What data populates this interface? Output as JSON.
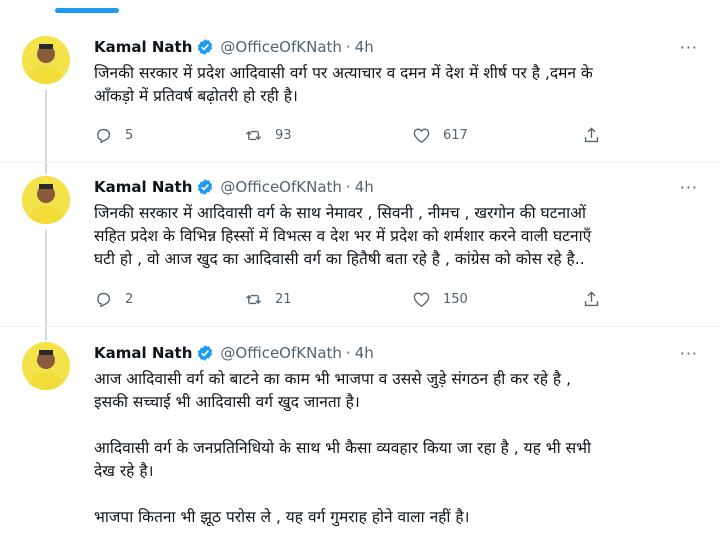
{
  "tweets": [
    {
      "name": "Kamal Nath",
      "handle": "@OfficeOfKNath",
      "time": "4h",
      "lines": [
        "जिनकी सरकार में प्रदेश आदिवासी वर्ग पर अत्याचार व दमन में देश में शीर्ष पर है ,दमन के",
        "आँकड़ो में प्रतिवर्ष बढ़ोतरी हो रही है।"
      ],
      "replies": "5",
      "retweets": "93",
      "likes": "617"
    },
    {
      "name": "Kamal Nath",
      "handle": "@OfficeOfKNath",
      "time": "4h",
      "lines": [
        "जिनकी सरकार में आदिवासी वर्ग के साथ नेमावर , सिवनी , नीमच , खरगोन की घटनाओं",
        "सहित प्रदेश के विभिन्न हिस्सों में विभत्स व देश भर में प्रदेश को शर्मशार करने वाली घटनाएँ",
        "घटी हो , वो आज खुद का आदिवासी वर्ग का हितैषी बता रहे है , कांग्रेस को कोस रहे है.."
      ],
      "replies": "2",
      "retweets": "21",
      "likes": "150"
    },
    {
      "name": "Kamal Nath",
      "handle": "@OfficeOfKNath",
      "time": "4h",
      "lines": [
        "आज आदिवासी वर्ग को बाटने का काम भी भाजपा व उससे जुड़े संगठन ही कर रहे है ,",
        "इसकी सच्चाई भी आदिवासी वर्ग खुद जानता है।",
        "",
        "आदिवासी वर्ग के जनप्रतिनिधियो के साथ भी कैसा व्यवहार किया जा रहा है , यह भी सभी",
        "देख रहे है।",
        "",
        "भाजपा कितना भी झूठ परोस ले , यह वर्ग गुमराह होने वाला नहीं है।"
      ]
    }
  ],
  "icons": {
    "reply": "reply-icon",
    "retweet": "retweet-icon",
    "like": "heart-icon",
    "share": "share-icon",
    "verified": "verified-badge-icon",
    "more": "more-icon"
  },
  "colors": {
    "accent": "#1d9bf0",
    "text": "#0f1419",
    "secondary": "#536471"
  }
}
